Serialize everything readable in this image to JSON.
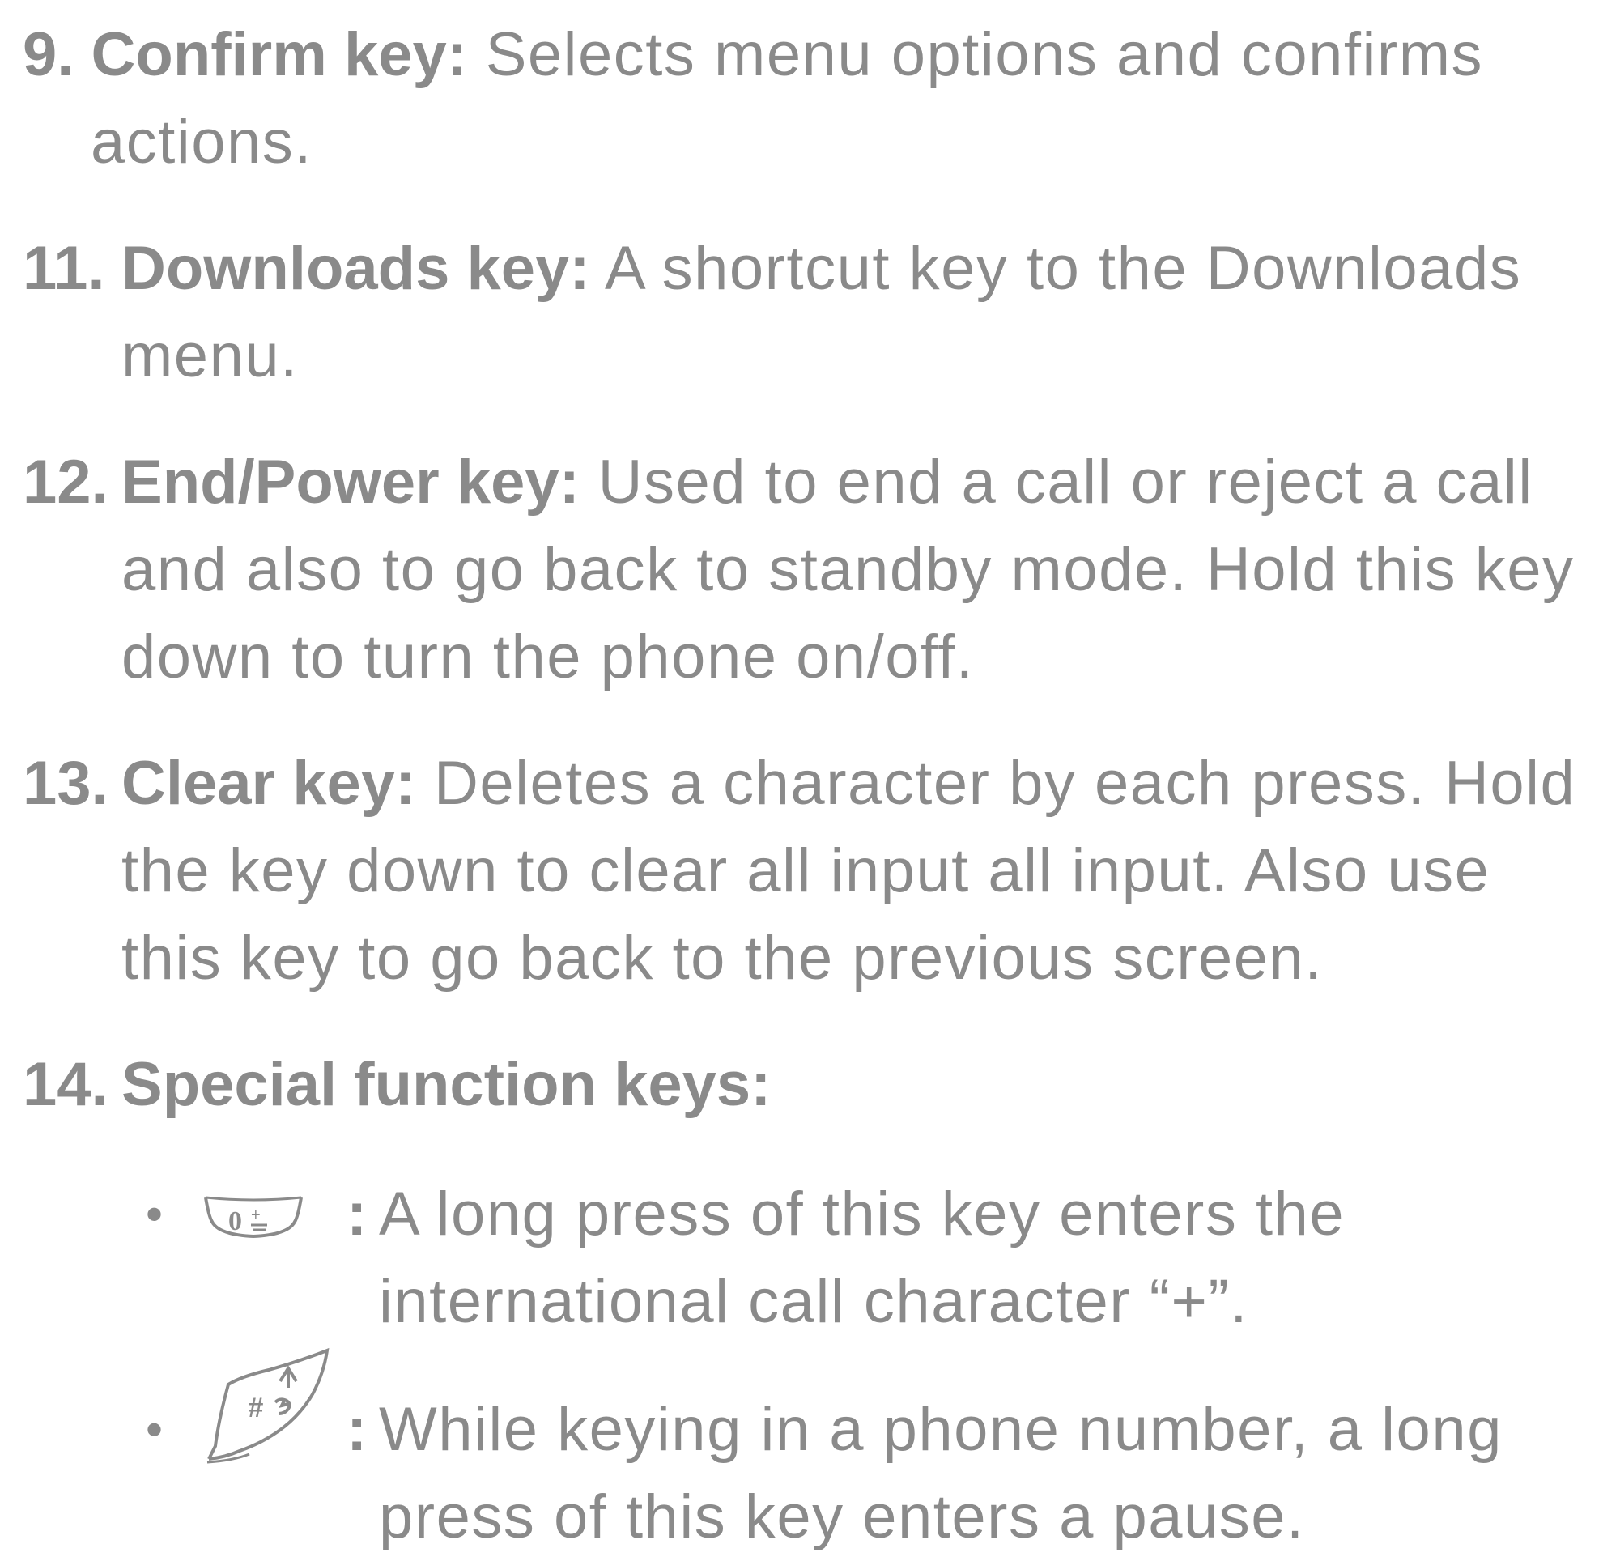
{
  "items": [
    {
      "number": "9.",
      "term": "Confirm key:",
      "text": "Selects menu options and confirms\nactions."
    },
    {
      "number": "11.",
      "term": "Downloads key:",
      "text": "A shortcut key to the Downloads\nmenu."
    },
    {
      "number": "12.",
      "term": "End/Power key:",
      "text": "Used to end a call or reject a call\nand also to go back to standby mode. Hold this key\ndown to turn the phone on/off."
    },
    {
      "number": "13.",
      "term": "Clear key:",
      "text": "Deletes a character by each press. Hold\nthe key down to clear all input all input. Also use\nthis key to go back to the previous screen."
    },
    {
      "number": "14.",
      "term": "Special function keys:",
      "text": ""
    }
  ],
  "special_keys": [
    {
      "bullet": "•",
      "icon": "zero-plus-key-icon",
      "colon": ":",
      "text": "A long press of this key enters the\ninternational call character “+”."
    },
    {
      "bullet": "•",
      "icon": "hash-key-icon",
      "colon": ":",
      "text": "While keying in a phone number, a long\npress of this key enters a pause."
    }
  ]
}
